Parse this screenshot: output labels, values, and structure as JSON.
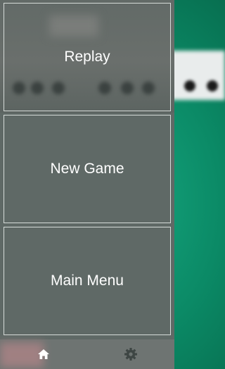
{
  "menu": {
    "replay_label": "Replay",
    "new_game_label": "New Game",
    "main_menu_label": "Main Menu"
  },
  "bottom_nav": {
    "items": [
      {
        "icon": "home-icon"
      },
      {
        "icon": "gear-icon"
      }
    ]
  },
  "colors": {
    "board_green": "#0c7a5e",
    "panel_gray": "#5f6966",
    "button_border": "#d6dcd9",
    "text": "#ffffff"
  }
}
